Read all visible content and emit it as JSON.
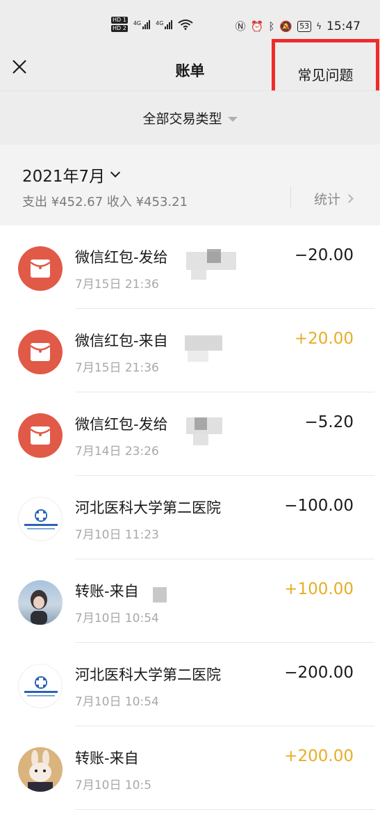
{
  "status_bar": {
    "hd1": "HD 1",
    "hd2": "HD 2",
    "net1": "4G",
    "net2": "4G",
    "battery": "53",
    "time": "15:47"
  },
  "navbar": {
    "title": "账单",
    "faq_label": "常见问题",
    "highlight_color": "#ef2b2b"
  },
  "filter": {
    "label": "全部交易类型"
  },
  "month": {
    "label": "2021年7月",
    "summary": "支出 ¥452.67 收入 ¥453.21",
    "stats_label": "统计"
  },
  "colors": {
    "income": "#e8ad24",
    "expense": "#1a1a1a",
    "red_packet": "#e05a47"
  },
  "transactions": [
    {
      "title": "微信红包-发给",
      "time": "7月15日 21:36",
      "amount": "−20.00",
      "avatar": "red-packet-icon"
    },
    {
      "title": "微信红包-来自",
      "time": "7月15日 21:36",
      "amount": "+20.00",
      "avatar": "red-packet-icon"
    },
    {
      "title": "微信红包-发给",
      "time": "7月14日 23:26",
      "amount": "−5.20",
      "avatar": "red-packet-icon"
    },
    {
      "title": "河北医科大学第二医院",
      "time": "7月10日 11:23",
      "amount": "−100.00",
      "avatar": "hospital-logo"
    },
    {
      "title": "转账-来自",
      "time": "7月10日 10:54",
      "amount": "+100.00",
      "avatar": "user-photo"
    },
    {
      "title": "河北医科大学第二医院",
      "time": "7月10日 10:54",
      "amount": "−200.00",
      "avatar": "hospital-logo"
    },
    {
      "title": "转账-来自",
      "time": "7月10日 10:5",
      "amount": "+200.00",
      "avatar": "user-photo"
    }
  ]
}
